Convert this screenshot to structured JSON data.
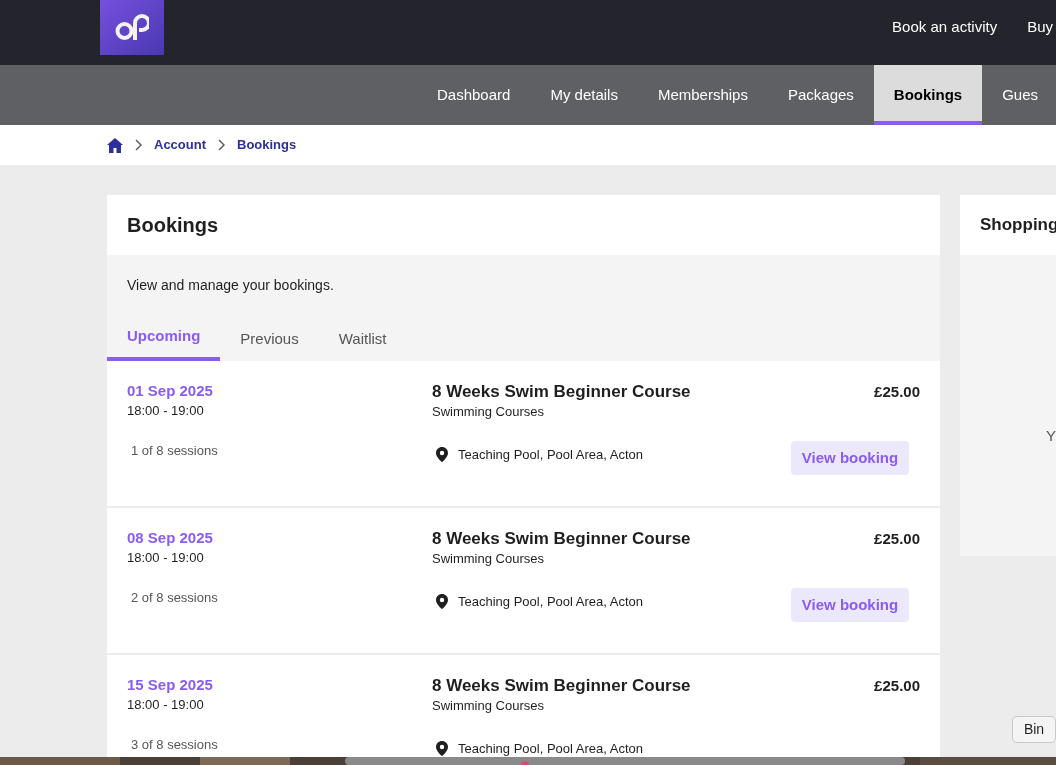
{
  "top_nav": [
    "Book an activity",
    "Buy"
  ],
  "account_nav": [
    {
      "label": "Dashboard",
      "selected": false
    },
    {
      "label": "My details",
      "selected": false
    },
    {
      "label": "Memberships",
      "selected": false
    },
    {
      "label": "Packages",
      "selected": false
    },
    {
      "label": "Bookings",
      "selected": true
    },
    {
      "label": "Gues",
      "selected": false
    }
  ],
  "breadcrumb": [
    "Account",
    "Bookings"
  ],
  "panel": {
    "title": "Bookings",
    "description": "View and manage your bookings.",
    "tabs": [
      {
        "label": "Upcoming",
        "selected": true
      },
      {
        "label": "Previous",
        "selected": false
      },
      {
        "label": "Waitlist",
        "selected": false
      }
    ],
    "bookings": [
      {
        "date": "01 Sep 2025",
        "time": "18:00 - 19:00",
        "sessions": "1 of 8 sessions",
        "title": "8 Weeks Swim Beginner Course",
        "category": "Swimming Courses",
        "location": "Teaching Pool, Pool Area, Acton",
        "price": "£25.00",
        "button": "View booking"
      },
      {
        "date": "08 Sep 2025",
        "time": "18:00 - 19:00",
        "sessions": "2 of 8 sessions",
        "title": "8 Weeks Swim Beginner Course",
        "category": "Swimming Courses",
        "location": "Teaching Pool, Pool Area, Acton",
        "price": "£25.00",
        "button": "View booking"
      },
      {
        "date": "15 Sep 2025",
        "time": "18:00 - 19:00",
        "sessions": "3 of 8 sessions",
        "title": "8 Weeks Swim Beginner Course",
        "category": "Swimming Courses",
        "location": "Teaching Pool, Pool Area, Acton",
        "price": "£25.00"
      }
    ]
  },
  "basket": {
    "title": "Shopping",
    "message": "Y"
  },
  "tooltip": "Bin"
}
